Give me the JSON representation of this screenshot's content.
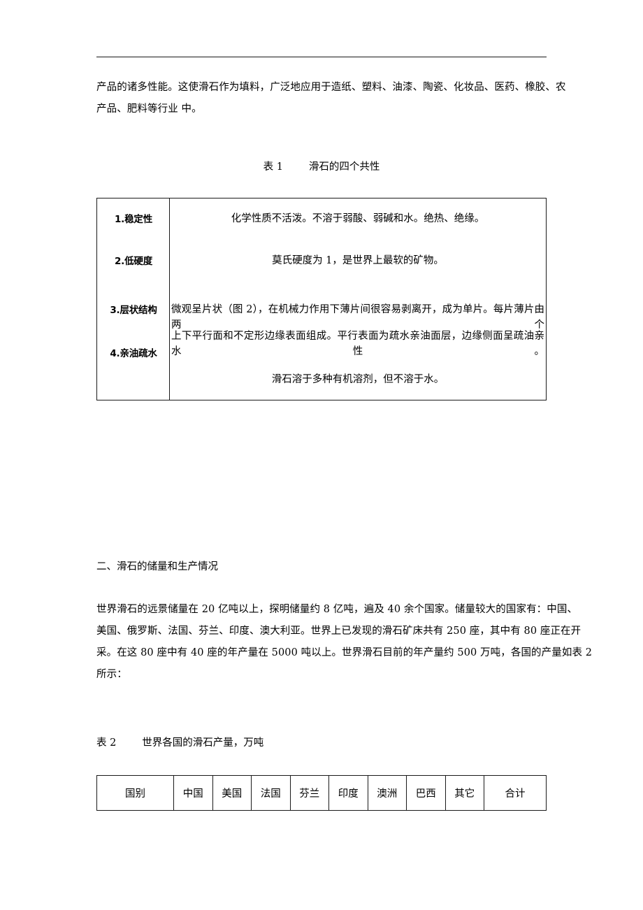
{
  "document": {
    "header_rule": true,
    "paragraphs": {
      "intro": {
        "lines": [
          "产品的诸多性能。这使滑石作为填料，广泛地应用于造纸、塑料、油漆、陶瓷、化妆品、医药、橡胶、农",
          "产品、肥料等行业 中。"
        ]
      },
      "section_heading": "二、滑石的储量和生产情况",
      "reserves": {
        "lines": [
          "世界滑石的远景储量在 20 亿吨以上，探明储量约 8 亿吨，遍及 40 余个国家。储量较大的国家有：中国、",
          "美国、俄罗斯、法国、芬兰、印度、澳大利亚。世界上已发现的滑石矿床共有 250 座，其中有 80 座正在开",
          "采。在这 80 座中有 40 座的年产量在 5000 吨以上。世界滑石目前的年产量约 500 万吨，各国的产量如表 2",
          "所示："
        ]
      }
    },
    "table1": {
      "caption_number": "表 1",
      "caption_title": "滑石的四个共性",
      "caption_full": "表 1        滑石的四个共性",
      "row_labels": [
        "1.稳定性",
        "2.低硬度",
        "3.层状结构",
        "4.亲油疏水"
      ],
      "description_lines": [
        "化学性质不活泼。不溶于弱酸、弱碱和水。绝热、绝缘。",
        "莫氏硬度为 1，是世界上最软的矿物。",
        "微观呈片状（图 2），在机械力作用下薄片间很容易剥离开，成为单片。每片薄片由两个",
        "上下平行面和不定形边缘表面组成。平行表面为疏水亲油面层，边缘侧面呈疏油亲水性。",
        "滑石溶于多种有机溶剂，但不溶于水。"
      ]
    },
    "table2": {
      "caption_number": "表 2",
      "caption_title": "世界各国的滑石产量，万吨",
      "caption_full": "表 2        世界各国的滑石产量，万吨",
      "headers": [
        "国别",
        "中国",
        "美国",
        "法国",
        "芬兰",
        "印度",
        "澳洲",
        "巴西",
        "其它",
        "合计"
      ]
    }
  }
}
